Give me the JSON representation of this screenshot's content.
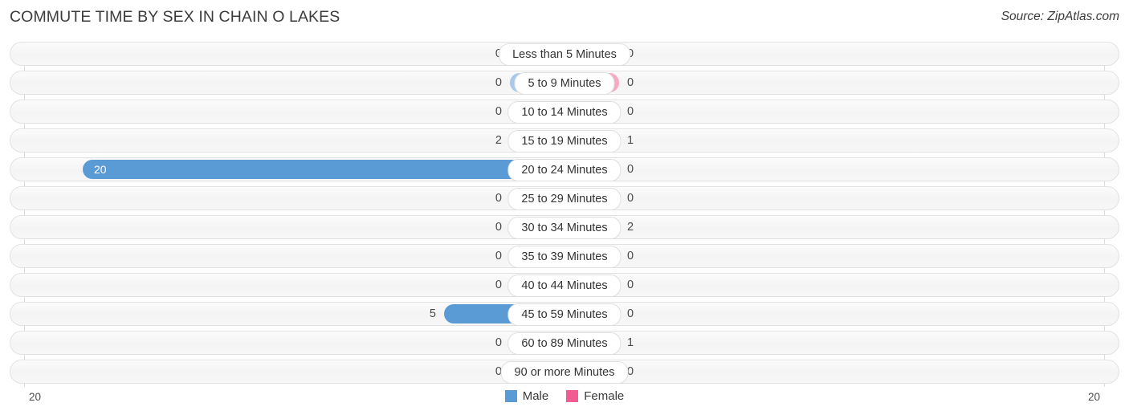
{
  "header": {
    "title": "COMMUTE TIME BY SEX IN CHAIN O LAKES",
    "source": "Source: ZipAtlas.com"
  },
  "legend": {
    "male_label": "Male",
    "female_label": "Female",
    "male_color": "#5b9bd5",
    "female_color": "#f15c92"
  },
  "axis": {
    "left_end_label": "20",
    "right_end_label": "20"
  },
  "colors": {
    "male_strong": "#5b9bd5",
    "male_pale": "#a8c8ec",
    "female_strong": "#f15c92",
    "female_pale": "#f8a8c4",
    "track": "#f6f6f6",
    "gridline": "#dcdcdc"
  },
  "chart_data": {
    "type": "bar",
    "subtype": "diverging-horizontal",
    "title": "COMMUTE TIME BY SEX IN CHAIN O LAKES",
    "xlabel": "",
    "ylabel": "",
    "xlim": [
      20,
      20
    ],
    "grid": true,
    "legend_position": "bottom-center",
    "categories": [
      "Less than 5 Minutes",
      "5 to 9 Minutes",
      "10 to 14 Minutes",
      "15 to 19 Minutes",
      "20 to 24 Minutes",
      "25 to 29 Minutes",
      "30 to 34 Minutes",
      "35 to 39 Minutes",
      "40 to 44 Minutes",
      "45 to 59 Minutes",
      "60 to 89 Minutes",
      "90 or more Minutes"
    ],
    "series": [
      {
        "name": "Male",
        "direction": "left",
        "color": "#5b9bd5",
        "values": [
          0,
          0,
          0,
          2,
          20,
          0,
          0,
          0,
          0,
          5,
          0,
          0
        ]
      },
      {
        "name": "Female",
        "direction": "right",
        "color": "#f15c92",
        "values": [
          0,
          0,
          0,
          1,
          0,
          0,
          2,
          0,
          0,
          0,
          1,
          0
        ]
      }
    ]
  },
  "rows": [
    {
      "label": "Less than 5 Minutes",
      "male": "0",
      "female": "0"
    },
    {
      "label": "5 to 9 Minutes",
      "male": "0",
      "female": "0"
    },
    {
      "label": "10 to 14 Minutes",
      "male": "0",
      "female": "0"
    },
    {
      "label": "15 to 19 Minutes",
      "male": "2",
      "female": "1"
    },
    {
      "label": "20 to 24 Minutes",
      "male": "20",
      "female": "0"
    },
    {
      "label": "25 to 29 Minutes",
      "male": "0",
      "female": "0"
    },
    {
      "label": "30 to 34 Minutes",
      "male": "0",
      "female": "2"
    },
    {
      "label": "35 to 39 Minutes",
      "male": "0",
      "female": "0"
    },
    {
      "label": "40 to 44 Minutes",
      "male": "0",
      "female": "0"
    },
    {
      "label": "45 to 59 Minutes",
      "male": "5",
      "female": "0"
    },
    {
      "label": "60 to 89 Minutes",
      "male": "0",
      "female": "1"
    },
    {
      "label": "90 or more Minutes",
      "male": "0",
      "female": "0"
    }
  ]
}
